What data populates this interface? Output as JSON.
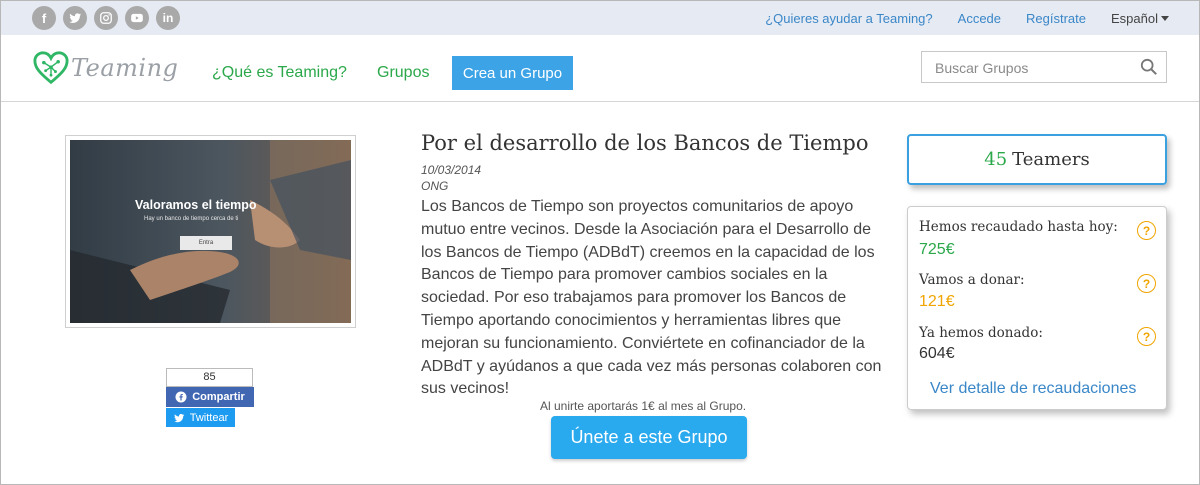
{
  "social": [
    {
      "icon": "facebook-icon",
      "glyph": "f"
    },
    {
      "icon": "twitter-icon",
      "glyph": ""
    },
    {
      "icon": "instagram-icon",
      "glyph": ""
    },
    {
      "icon": "youtube-icon",
      "glyph": ""
    },
    {
      "icon": "linkedin-icon",
      "glyph": "in"
    }
  ],
  "top_links": {
    "help": "¿Quieres ayudar a Teaming?",
    "login": "Accede",
    "register": "Regístrate",
    "language": "Español"
  },
  "nav": {
    "logo": "Teaming",
    "what": "¿Qué es Teaming?",
    "groups": "Grupos",
    "create": "Crea un Grupo",
    "search_placeholder": "Buscar Grupos"
  },
  "image": {
    "title": "Valoramos el tiempo",
    "subtitle": "Hay un banco de tiempo cerca de ti",
    "button": "Entra"
  },
  "share": {
    "count": "85",
    "share": "Compartir",
    "tweet": "Twittear"
  },
  "group": {
    "title": "Por el desarrollo de los Bancos de Tiempo",
    "date": "10/03/2014",
    "category": "ONG",
    "description": "Los Bancos de Tiempo son proyectos comunitarios de apoyo mutuo entre vecinos. Desde la Asociación para el Desarrollo de los Bancos de Tiempo (ADBdT) creemos en la capacidad de los Bancos de Tiempo para promover cambios sociales en la sociedad. Por eso trabajamos para promover los Bancos de Tiempo aportando conocimientos y herramientas libres que mejoran su funcionamiento. Conviértete en cofinanciador de la ADBdT y ayúdanos a que cada vez más personas colaboren con sus vecinos!",
    "join_note": "Al unirte aportarás 1€ al mes al Grupo.",
    "join": "Únete a este Grupo"
  },
  "stats": {
    "teamers_count": "45",
    "teamers_label": "Teamers",
    "raised_label": "Hemos recaudado hasta hoy:",
    "raised": "725€",
    "to_donate_label": "Vamos a donar:",
    "to_donate": "121€",
    "donated_label": "Ya hemos donado:",
    "donated": "604€",
    "help_glyph": "?",
    "detail": "Ver detalle de recaudaciones"
  },
  "colors": {
    "accent_blue": "#3ba3e6",
    "brand_green": "#2aa84a",
    "raised_green": "#2aa84a",
    "donate_orange": "#f0a500",
    "donated_dark": "#333333"
  }
}
